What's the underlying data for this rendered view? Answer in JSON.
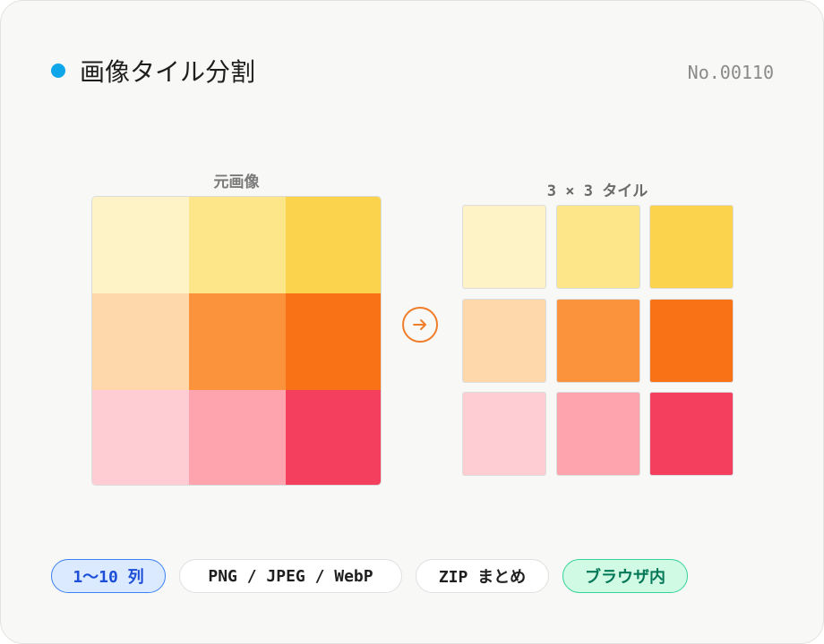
{
  "header": {
    "title": "画像タイル分割",
    "serial": "No.00110",
    "dot_color": "#0ea5e9"
  },
  "source": {
    "label": "元画像",
    "colors": [
      "#fef3c7",
      "#fde68a",
      "#fcd34d",
      "#fed7aa",
      "#fb923c",
      "#f97316",
      "#fecdd3",
      "#fda4af",
      "#f43f5e"
    ]
  },
  "arrow": {
    "icon": "arrow-right-icon",
    "color": "#f07d2a"
  },
  "tiles": {
    "label": "3 × 3 タイル",
    "colors": [
      "#fef3c7",
      "#fde68a",
      "#fcd34d",
      "#fed7aa",
      "#fb923c",
      "#f97316",
      "#fecdd3",
      "#fda4af",
      "#f43f5e"
    ]
  },
  "chips": [
    {
      "label": "1〜10 列",
      "style": "blue"
    },
    {
      "label": "PNG / JPEG / WebP",
      "style": "plain"
    },
    {
      "label": "ZIP まとめ",
      "style": "plain"
    },
    {
      "label": "ブラウザ内",
      "style": "green"
    }
  ]
}
